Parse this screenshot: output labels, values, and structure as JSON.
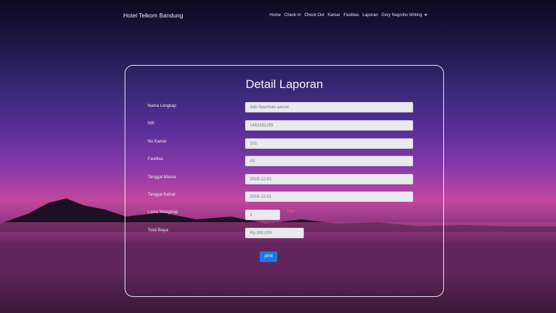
{
  "navbar": {
    "brand": "Hotel Telkom Bandung",
    "links": [
      "Home",
      "Check In",
      "Check Out",
      "Kamar",
      "Fasilitas",
      "Laporan"
    ],
    "user": "Gery Nugroho Writing"
  },
  "page": {
    "title": "Detail Laporan"
  },
  "form": {
    "fields": [
      {
        "label": "Nama Lengkap",
        "value": "Arbi Nourman aaruni"
      },
      {
        "label": "NIK",
        "value": "1452151255"
      },
      {
        "label": "No Kamar",
        "value": "101"
      },
      {
        "label": "Fasilitas",
        "value": "A1"
      },
      {
        "label": "Tanggal Masuk",
        "value": "2019-12-01"
      },
      {
        "label": "Tanggal Keluar",
        "value": "2019-12-01"
      },
      {
        "label": "Lama Menginap",
        "value": "1",
        "suffix": "Hari"
      },
      {
        "label": "Total Biaya",
        "value": "Rp.300,000"
      }
    ],
    "print_label": "print"
  },
  "colors": {
    "accent": "#1b7ae6",
    "suffix": "#ff5d5d"
  }
}
